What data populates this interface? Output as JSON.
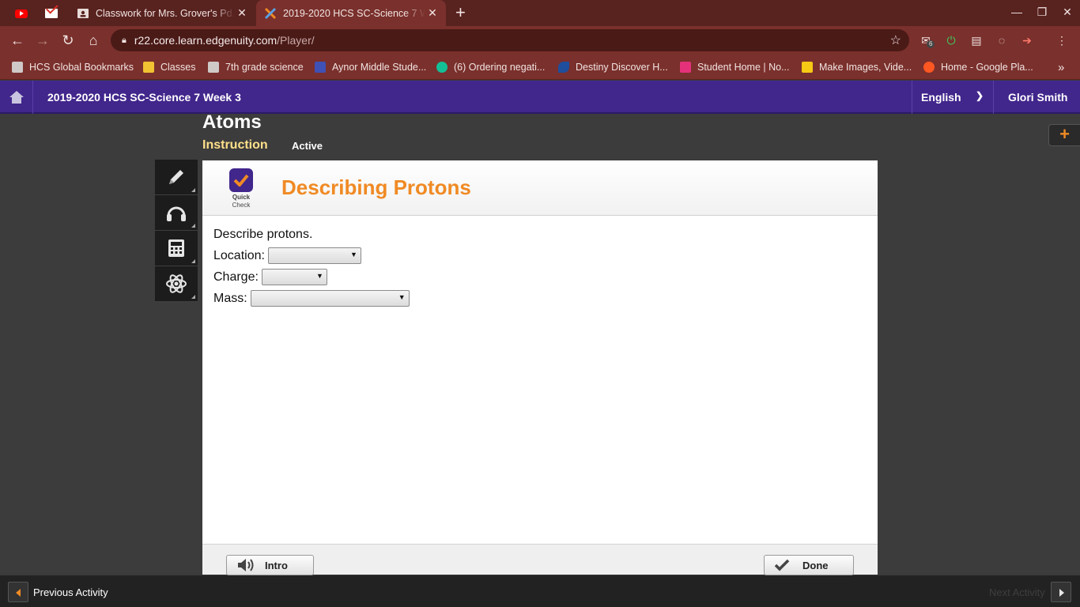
{
  "browser": {
    "pinned_tabs": [
      {
        "icon": "youtube-icon"
      },
      {
        "icon": "gmail-icon"
      }
    ],
    "tabs": [
      {
        "title": "Classwork for Mrs. Grover's Pd. 2",
        "active": false,
        "icon": "classroom-icon"
      },
      {
        "title": "2019-2020 HCS SC-Science 7 W",
        "active": true,
        "icon": "edgenuity-icon"
      }
    ],
    "url_host": "r22.core.learn.edgenuity.com",
    "url_path": "/Player/",
    "extension_badge": "6",
    "bookmarks": [
      {
        "label": "HCS Global Bookmarks",
        "icon": "bookmark-folder-icon",
        "color": "#cfc9c8"
      },
      {
        "label": "Classes",
        "icon": "classroom-icon",
        "color": "#f1c232"
      },
      {
        "label": "7th grade science",
        "icon": "folder-icon",
        "color": "#cfc9c8"
      },
      {
        "label": "Aynor Middle Stude...",
        "icon": "forms-icon",
        "color": "#3f51b5"
      },
      {
        "label": "(6) Ordering negati...",
        "icon": "khan-icon",
        "color": "#14bf96"
      },
      {
        "label": "Destiny Discover H...",
        "icon": "destiny-icon",
        "color": "#1f4e9c"
      },
      {
        "label": "Student Home | No...",
        "icon": "nearpod-icon",
        "color": "#e5317a"
      },
      {
        "label": "Make Images, Vide...",
        "icon": "spark-icon",
        "color": "#f6c915"
      },
      {
        "label": "Home - Google Pla...",
        "icon": "play-music-icon",
        "color": "#ff5722"
      }
    ]
  },
  "app": {
    "course_title": "2019-2020 HCS SC-Science 7 Week 3",
    "language": "English",
    "user_name": "Glori Smith",
    "lesson_title": "Atoms",
    "lesson_tab": "Instruction",
    "lesson_status": "Active",
    "tools": [
      {
        "icon": "pencil-icon"
      },
      {
        "icon": "headphones-icon"
      },
      {
        "icon": "calculator-icon"
      },
      {
        "icon": "atom-icon"
      }
    ],
    "activity": {
      "badge_line1": "Quick",
      "badge_line2": "Check",
      "title": "Describing Protons",
      "prompt": "Describe protons.",
      "fields": [
        {
          "label": "Location:",
          "value": ""
        },
        {
          "label": "Charge:",
          "value": ""
        },
        {
          "label": "Mass:",
          "value": ""
        }
      ],
      "intro_button": "Intro",
      "done_button": "Done"
    },
    "footer": {
      "prev_label": "Previous Activity",
      "next_label": "Next Activity"
    },
    "colors": {
      "app_bar": "#41268c",
      "accent_orange": "#f08a24",
      "chrome_frame": "#58221f",
      "chrome_toolbar": "#7a302c"
    }
  }
}
